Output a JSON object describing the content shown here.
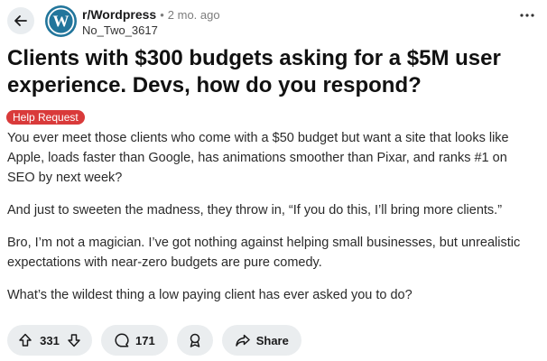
{
  "header": {
    "subreddit": "r/Wordpress",
    "separator": "•",
    "time_ago": "2 mo. ago",
    "username": "No_Two_3617",
    "more_label": "…",
    "avatar_letter": "W"
  },
  "post": {
    "title": "Clients with $300 budgets asking for a $5M user experience. Devs, how do you respond?",
    "flair": "Help Request",
    "paragraphs": [
      "You ever meet those clients who come with a $50 budget but want a site that looks like Apple, loads faster than Google, has animations smoother than Pixar, and ranks #1 on SEO by next week?",
      "And just to sweeten the madness, they throw in, “If you do this, I’ll bring more clients.”",
      "Bro, I’m not a magician. I’ve got nothing against helping small businesses, but unrealistic expectations with near-zero budgets are pure comedy.",
      "What’s the wildest thing a low paying client has ever asked you to do?"
    ]
  },
  "actions": {
    "votes": "331",
    "comments": "171",
    "share_label": "Share"
  },
  "colors": {
    "flair_bg": "#d93a3a",
    "avatar_bg": "#21759b",
    "pill_bg": "#eaedef"
  }
}
